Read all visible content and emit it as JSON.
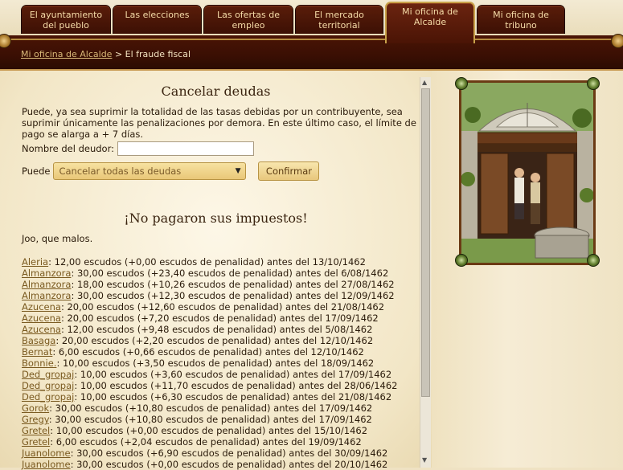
{
  "tabs": [
    {
      "label": "El ayuntamiento del pueblo",
      "active": false
    },
    {
      "label": "Las elecciones",
      "active": false
    },
    {
      "label": "Las ofertas de empleo",
      "active": false
    },
    {
      "label": "El mercado territorial",
      "active": false
    },
    {
      "label": "Mi oficina de Alcalde",
      "active": true
    },
    {
      "label": "Mi oficina de tribuno",
      "active": false
    }
  ],
  "breadcrumb": {
    "link": "Mi oficina de Alcalde",
    "separator": ">",
    "current": "El fraude fiscal"
  },
  "cancel": {
    "title": "Cancelar deudas",
    "description": "Puede, ya sea suprimir la totalidad de las tasas debidas por un contribuyente, sea suprimir únicamente las penalizaciones por demora. En este último caso, el límite de pago se alarga a + 7 días.",
    "debtor_label": "Nombre del deudor:",
    "debtor_value": "",
    "action_label": "Puede",
    "action_selected": "Cancelar todas las deudas",
    "confirm_label": "Confirmar"
  },
  "unpaid": {
    "title": "¡No pagaron sus impuestos!",
    "subtitle": "Joo, que malos.",
    "entries": [
      {
        "name": "Aleria",
        "text": ": 12,00 escudos (+0,00 escudos de penalidad) antes del 13/10/1462"
      },
      {
        "name": "Almanzora",
        "text": ": 30,00 escudos (+23,40 escudos de penalidad) antes del 6/08/1462"
      },
      {
        "name": "Almanzora",
        "text": ": 18,00 escudos (+10,26 escudos de penalidad) antes del 27/08/1462"
      },
      {
        "name": "Almanzora",
        "text": ": 30,00 escudos (+12,30 escudos de penalidad) antes del 12/09/1462"
      },
      {
        "name": "Azucena",
        "text": ": 20,00 escudos (+12,60 escudos de penalidad) antes del 21/08/1462"
      },
      {
        "name": "Azucena",
        "text": ": 20,00 escudos (+7,20 escudos de penalidad) antes del 17/09/1462"
      },
      {
        "name": "Azucena",
        "text": ": 12,00 escudos (+9,48 escudos de penalidad) antes del 5/08/1462"
      },
      {
        "name": "Basaga",
        "text": ": 20,00 escudos (+2,20 escudos de penalidad) antes del 12/10/1462"
      },
      {
        "name": "Bernat",
        "text": ": 6,00 escudos (+0,66 escudos de penalidad) antes del 12/10/1462"
      },
      {
        "name": "Bonnie.",
        "text": ": 10,00 escudos (+3,50 escudos de penalidad) antes del 18/09/1462"
      },
      {
        "name": "Ded_gropaj",
        "text": ": 10,00 escudos (+3,60 escudos de penalidad) antes del 17/09/1462"
      },
      {
        "name": "Ded_gropaj",
        "text": ": 10,00 escudos (+11,70 escudos de penalidad) antes del 28/06/1462"
      },
      {
        "name": "Ded_gropaj",
        "text": ": 10,00 escudos (+6,30 escudos de penalidad) antes del 21/08/1462"
      },
      {
        "name": "Gorok",
        "text": ": 30,00 escudos (+10,80 escudos de penalidad) antes del 17/09/1462"
      },
      {
        "name": "Gregy",
        "text": ": 30,00 escudos (+10,80 escudos de penalidad) antes del 17/09/1462"
      },
      {
        "name": "Gretel",
        "text": ": 10,00 escudos (+0,00 escudos de penalidad) antes del 15/10/1462"
      },
      {
        "name": "Gretel",
        "text": ": 6,00 escudos (+2,04 escudos de penalidad) antes del 19/09/1462"
      },
      {
        "name": "Juanolome",
        "text": ": 30,00 escudos (+6,90 escudos de penalidad) antes del 30/09/1462"
      },
      {
        "name": "Juanolome",
        "text": ": 30,00 escudos (+0,00 escudos de penalidad) antes del 20/10/1462"
      }
    ]
  }
}
